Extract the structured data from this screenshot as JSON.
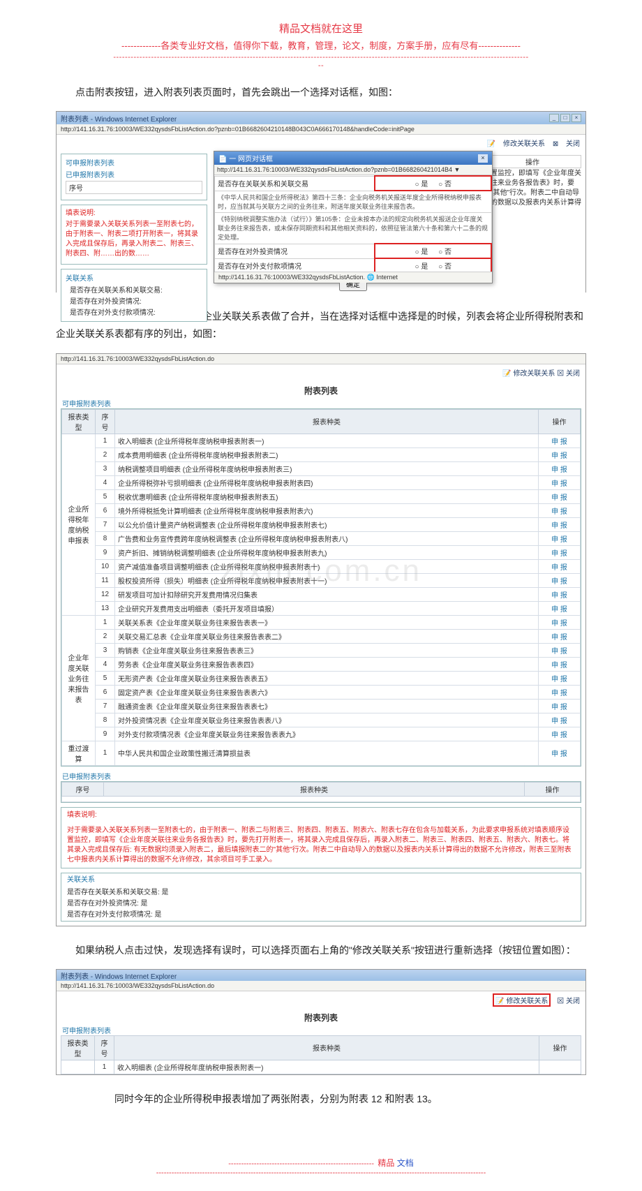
{
  "header": {
    "title": "精品文档就在这里",
    "subtitle": "-------------各类专业好文档，值得你下载，教育，管理，论文，制度，方案手册，应有尽有--------------",
    "dashes1": "-----------------------------------------------------------------------------------------------------------------------------------------------",
    "dashes2": "--"
  },
  "para1": "点击附表按钮，进入附表列表页面时，首先会跳出一个选择对话框，如图：",
  "ss1": {
    "title": "附表列表 - Windows Internet Explorer",
    "url": "http://141.16.31.76:10003/WE332qysdsFbListAction.do?pznb=01B6682604210148B043C0A666170148&handleCode=initPage",
    "tool_modify": "修改关联关系",
    "tool_close": "关闭",
    "left_sect1": "可申报附表列表",
    "left_sect1_sub": "已申报附表列表",
    "left_row": "序号",
    "fill_label": "填表说明:",
    "fill_text": "对于需要录入关联关系列表一至附表七的，由于附表一、附表二项打开附表一，将其录入完成且保存后，再录入附表二、附表三、附表四、附……出的数……",
    "rel_label": "关联关系",
    "rel_q1": "是否存在关联关系和关联交易:",
    "rel_q2": "是否存在对外投资情况:",
    "rel_q3": "是否存在对外支付款项情况:",
    "ops_header": "操作",
    "ops_note": "设置监控，即填写《企业年度关联往来业务各报告表》时，要先\"其他\"行次。附表二中自动导入的数据以及报表内关系计算得",
    "modal": {
      "title": "一 网页对话框",
      "addr": "http://141.16.31.76:10003/WE332qysdsFbListAction.do?pznb=01B668260421014B4 ▼",
      "q1": "是否存在关联关系和关联交易",
      "yes": "是",
      "no": "否",
      "note1": "《中华人民共和国企业所得税法》第四十三条：企业向税务机关报送年度企业所得税纳税申报表时，应当就其与关联方之间的业务往来，附送年度关联业务往来报告表。",
      "note2": "《特别纳税调整实施办法（试行）》第105条：企业未按本办法的规定向税务机关报送企业年度关联业务往来报告表，或未保存同期资料和其他相关资料的，依照征管法第六十条和第六十二条的规定处理。",
      "q2": "是否存在对外投资情况",
      "q3": "是否存在对外支付款项情况",
      "ok": "确定",
      "status": "http://141.16.31.76:10003/WE332qysdsFbListAction. 🌐 Internet"
    }
  },
  "para2": "本年新的企业所得税申报表和企业关联关系表做了合并，当在选择对话框中选择是的时候，列表会将企业所得税附表和企业关联关系表都有序的列出，如图：",
  "ss2": {
    "url": "http://141.16.31.76:10003/WE332qysdsFbListAction.do",
    "tool_modify": "修改关联关系",
    "tool_close": "关闭",
    "sect_title": "附表列表",
    "group1": "可申报附表列表",
    "th_type": "报表类型",
    "th_idx": "序号",
    "th_name": "报表种类",
    "th_op": "操作",
    "op_label": "申 报",
    "typeA": "企业所得税年度纳税申报表",
    "rowsA": [
      "收入明细表 (企业所得税年度纳税申报表附表一)",
      "成本费用明细表 (企业所得税年度纳税申报表附表二)",
      "纳税调整项目明细表 (企业所得税年度纳税申报表附表三)",
      "企业所得税弥补亏损明细表 (企业所得税年度纳税申报表附表四)",
      "税收优惠明细表 (企业所得税年度纳税申报表附表五)",
      "境外所得税抵免计算明细表 (企业所得税年度纳税申报表附表六)",
      "以公允价值计量资产纳税调整表 (企业所得税年度纳税申报表附表七)",
      "广告费和业务宣传费跨年度纳税调整表 (企业所得税年度纳税申报表附表八)",
      "资产折旧、摊销纳税调整明细表 (企业所得税年度纳税申报表附表九)",
      "资产减值准备项目调整明细表 (企业所得税年度纳税申报表附表十)",
      "股权投资所得（损失）明细表 (企业所得税年度纳税申报表附表十一)",
      "研发项目可加计扣除研究开发费用情况归集表",
      "企业研究开发费用支出明细表（委托开发项目填报）"
    ],
    "typeB": "企业年度关联业务往来报告表",
    "rowsB": [
      "关联关系表《企业年度关联业务往来报告表表一》",
      "关联交易汇总表《企业年度关联业务往来报告表表二》",
      "购销表《企业年度关联业务往来报告表表三》",
      "劳务表《企业年度关联业务往来报告表表四》",
      "无形资产表《企业年度关联业务往来报告表表五》",
      "固定资产表《企业年度关联业务往来报告表表六》",
      "融通资金表《企业年度关联业务往来报告表表七》",
      "对外投资情况表《企业年度关联业务往来报告表表八》",
      "对外支付款项情况表《企业年度关联业务往来报告表表九》"
    ],
    "typeC": "重过渡算",
    "rowsC": [
      "中华人民共和国企业政策性搬迁清算损益表"
    ],
    "group2": "已申报附表列表",
    "th2_idx": "序号",
    "th2_name": "报表种类",
    "th2_op": "操作",
    "fill_label": "填表说明:",
    "fill_text": "对于需要录入关联关系列表一至附表七的，由于附表一、附表二与附表三、附表四、附表五、附表六、附表七存在包含与加载关系，为此要求申报系统对填表顺序设置监控，即填写《企业年度关联往来业务各报告表》时，要先打开附表一，将其录入完成且保存后，再录入附表二、附表三、附表四、附表五、附表六、附表七。将其录入完成且保存后: 有无数据均须录入附表二，最后填报附表二的\"其他\"行次。附表二中自动导入的数据以及报表内关系计算得出的数据不允许修改，附表三至附表七中报表内关系计算得出的数据不允许修改，其余项目可手工录入。",
    "rel_label": "关联关系",
    "rel_r1": "是否存在关联关系和关联交易:  是",
    "rel_r2": "是否存在对外投资情况:       是",
    "rel_r3": "是否存在对外支付款项情况:    是",
    "watermark": "zixin.com.cn"
  },
  "para3": "如果纳税人点击过快，发现选择有误时，可以选择页面右上角的\"修改关联关系\"按钮进行重新选择（按钮位置如图）：",
  "ss3": {
    "title": "附表列表 - Windows Internet Explorer",
    "url": "http://141.16.31.76:10003/WE332qysdsFbListAction.do",
    "modify": "修改关联关系",
    "close": "关闭",
    "sect_title": "附表列表",
    "group": "可申报附表列表",
    "th_type": "报表类型",
    "th_idx": "序号",
    "th_name": "报表种类",
    "th_op": "操作",
    "row1": "收入明细表 (企业所得税年度纳税申报表附表一)"
  },
  "para4": "同时今年的企业所得税申报表增加了两张附表，分别为附表 12 和附表 13。",
  "footer": {
    "dashes": "---------------------------------------------------------",
    "a": "精品",
    "b": " 文档",
    "dashes2": "---------------------------------------------------------------------------------------------------------------------------------"
  }
}
